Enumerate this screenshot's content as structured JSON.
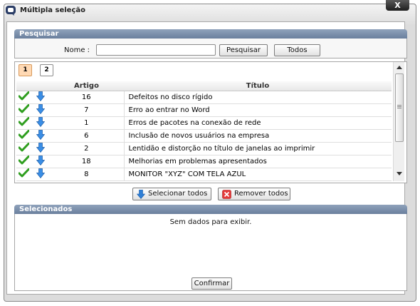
{
  "window": {
    "title": "Múltipla seleção",
    "close_label": "X"
  },
  "search": {
    "section_title": "Pesquisar",
    "name_label": "Nome :",
    "name_value": "",
    "search_button": "Pesquisar",
    "all_button": "Todos"
  },
  "pagination": {
    "pages": [
      "1",
      "2"
    ],
    "current": "1"
  },
  "grid": {
    "columns": [
      "Artigo",
      "Título"
    ],
    "rows": [
      {
        "artigo": "16",
        "titulo": "Defeitos no disco rígido"
      },
      {
        "artigo": "7",
        "titulo": "Erro ao entrar no Word"
      },
      {
        "artigo": "1",
        "titulo": "Erros de pacotes na conexão de rede"
      },
      {
        "artigo": "6",
        "titulo": "Inclusão de novos usuários na empresa"
      },
      {
        "artigo": "2",
        "titulo": "Lentidão e distorção no título de janelas ao imprimir"
      },
      {
        "artigo": "18",
        "titulo": "Melhorias em problemas apresentados"
      },
      {
        "artigo": "8",
        "titulo": "MONITOR \"XYZ\" COM TELA AZUL"
      }
    ],
    "row_icons": [
      "check-icon",
      "arrow-down-icon"
    ]
  },
  "actions": {
    "select_all": "Selecionar todos",
    "remove_all": "Remover todos"
  },
  "selected": {
    "section_title": "Selecionados",
    "empty_message": "Sem dados para exibir.",
    "confirm_button": "Confirmar"
  },
  "colors": {
    "header": "#7488a6",
    "check": "#2f9e1f",
    "arrow": "#2f7fd6",
    "remove": "#d42222",
    "page_active": "#ffd9b4"
  }
}
